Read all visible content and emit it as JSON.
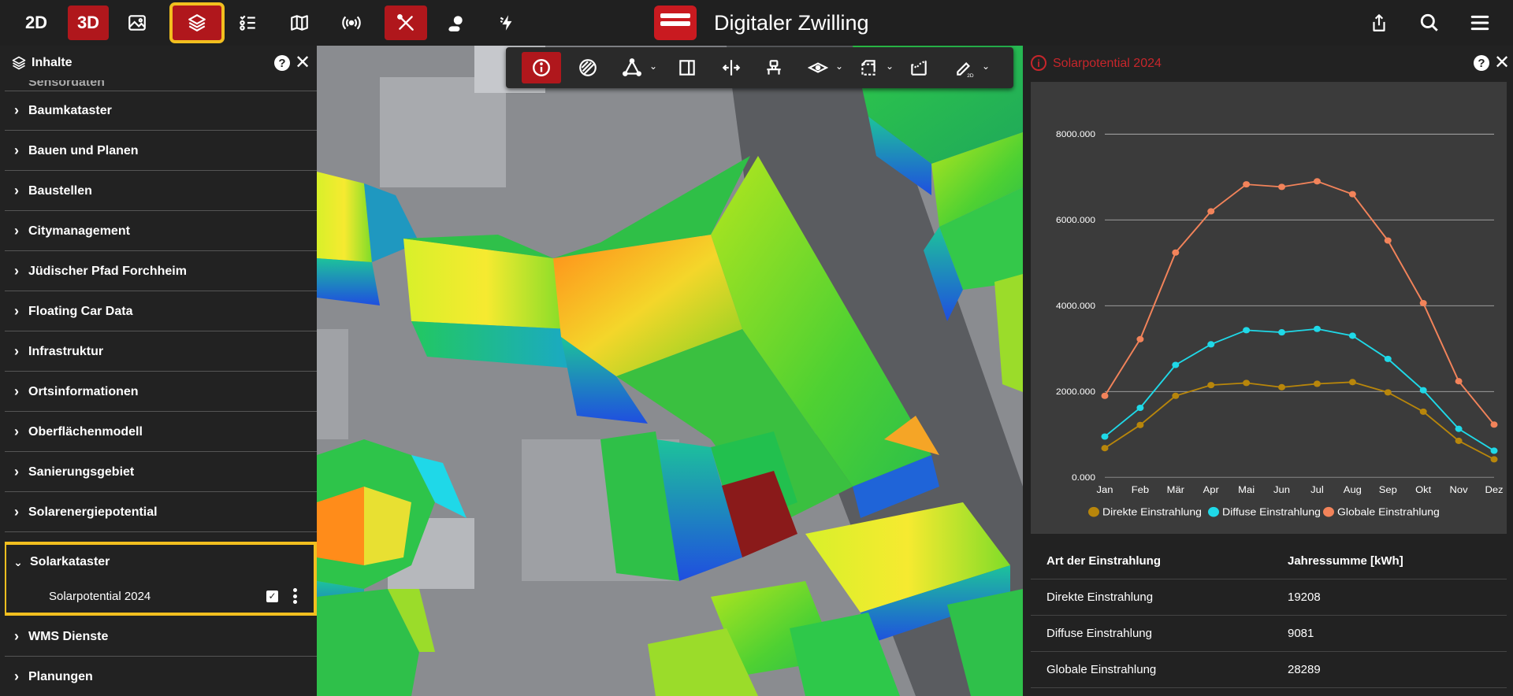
{
  "topbar": {
    "btn_2d": "2D",
    "btn_3d": "3D",
    "app_title": "Digitaler Zwilling",
    "icons": [
      "image-icon",
      "layers-icon",
      "legend-list-icon",
      "map-icon",
      "broadcast-icon",
      "tools-icon",
      "weather-icon",
      "flash-icon",
      "share-icon",
      "search-icon",
      "menu-icon"
    ]
  },
  "left_panel": {
    "title": "Inhalte",
    "partial_item": "Sensordaten",
    "categories": [
      "Baumkataster",
      "Bauen und Planen",
      "Baustellen",
      "Citymanagement",
      "Jüdischer Pfad Forchheim",
      "Floating Car Data",
      "Infrastruktur",
      "Ortsinformationen",
      "Oberflächenmodell",
      "Sanierungsgebiet",
      "Solarenergiepotential"
    ],
    "expanded_category": "Solarkataster",
    "sub_item": "Solarpotential 2024",
    "after_categories": [
      "WMS Dienste",
      "Planungen"
    ]
  },
  "right_panel": {
    "title": "Solarpotential 2024",
    "table": {
      "headers": [
        "Art der Einstrahlung",
        "Jahressumme [kWh]"
      ],
      "rows": [
        [
          "Direkte Einstrahlung",
          "19208"
        ],
        [
          "Diffuse Einstrahlung",
          "9081"
        ],
        [
          "Globale Einstrahlung",
          "28289"
        ]
      ]
    }
  },
  "colors": {
    "accent_red": "#b0171c",
    "highlight_yellow": "#f2bf1f",
    "direkt": "#b8860b",
    "diffus": "#1fd9e8",
    "global": "#f2835a"
  },
  "chart_data": {
    "type": "line",
    "categories": [
      "Jan",
      "Feb",
      "Mär",
      "Apr",
      "Mai",
      "Jun",
      "Jul",
      "Aug",
      "Sep",
      "Okt",
      "Nov",
      "Dez"
    ],
    "yticks": [
      "0.000",
      "2000.000",
      "4000.000",
      "6000.000",
      "8000.000"
    ],
    "ylim": [
      0,
      8000
    ],
    "grid": true,
    "legend_position": "bottom",
    "series": [
      {
        "name": "Direkte Einstrahlung",
        "color": "#b8860b",
        "values": [
          680,
          1220,
          1900,
          2150,
          2200,
          2100,
          2180,
          2220,
          1980,
          1530,
          850,
          420
        ]
      },
      {
        "name": "Diffuse Einstrahlung",
        "color": "#1fd9e8",
        "values": [
          950,
          1620,
          2620,
          3100,
          3430,
          3380,
          3460,
          3300,
          2760,
          2030,
          1130,
          620
        ]
      },
      {
        "name": "Globale Einstrahlung",
        "color": "#f2835a",
        "values": [
          1900,
          3220,
          5240,
          6200,
          6830,
          6770,
          6900,
          6600,
          5520,
          4060,
          2240,
          1230
        ]
      }
    ]
  }
}
